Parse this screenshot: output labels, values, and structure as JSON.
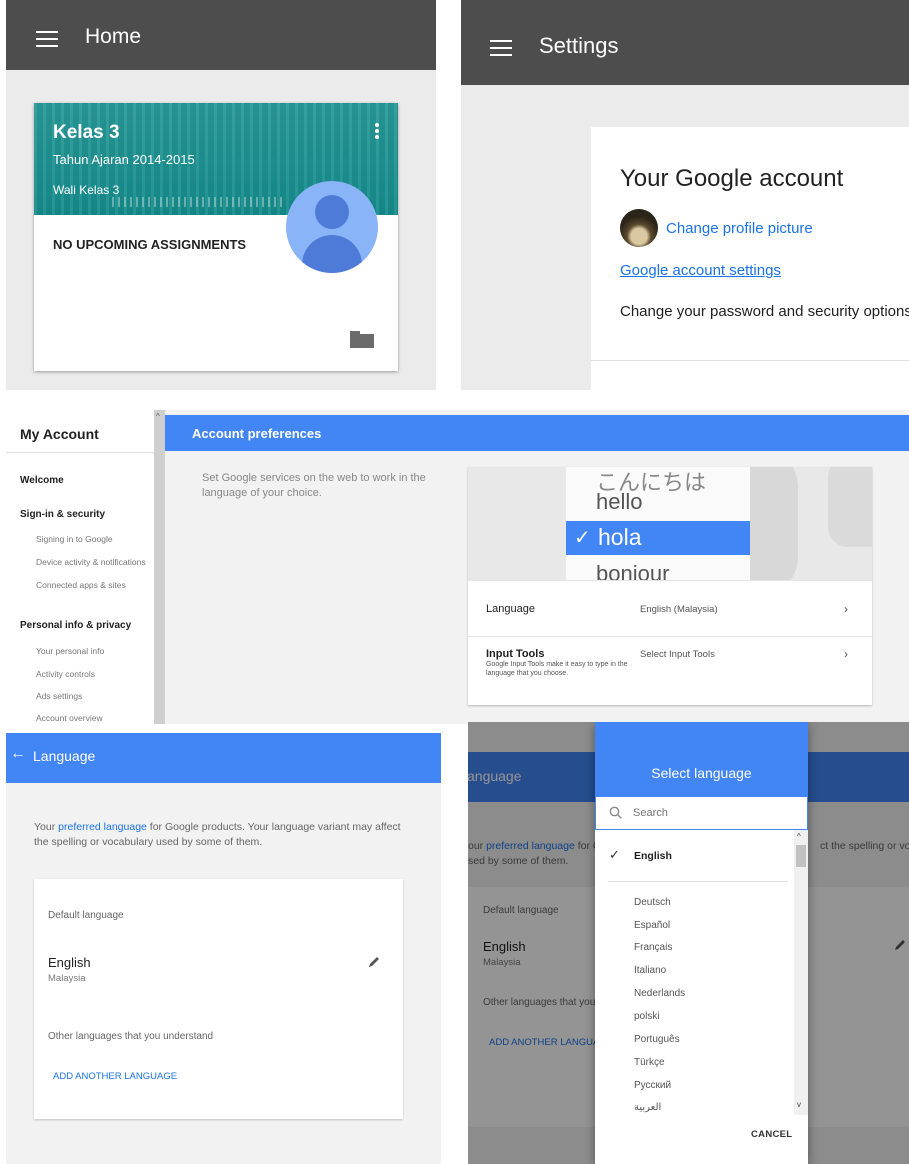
{
  "home": {
    "title": "Home",
    "class_card": {
      "name": "Kelas 3",
      "year": "Tahun Ajaran 2014-2015",
      "teacher": "Wali Kelas 3",
      "status": "NO UPCOMING ASSIGNMENTS"
    },
    "colors": {
      "appbar": "#4d4d4d",
      "card_header": "#1f9393",
      "avatar": "#8ab4f8"
    }
  },
  "settings": {
    "title": "Settings",
    "heading": "Your Google account",
    "change_picture": "Change profile picture",
    "account_settings_link": "Google account settings",
    "description": "Change your password and security options,"
  },
  "my_account": {
    "sidebar": {
      "title": "My Account",
      "items": [
        {
          "label": "Welcome",
          "type": "section"
        },
        {
          "label": "Sign-in & security",
          "type": "section"
        },
        {
          "label": "Signing in to Google",
          "type": "sub"
        },
        {
          "label": "Device activity & notifications",
          "type": "sub"
        },
        {
          "label": "Connected apps & sites",
          "type": "sub"
        },
        {
          "label": "Personal info & privacy",
          "type": "section"
        },
        {
          "label": "Your personal info",
          "type": "sub"
        },
        {
          "label": "Activity controls",
          "type": "sub"
        },
        {
          "label": "Ads settings",
          "type": "sub"
        },
        {
          "label": "Account overview",
          "type": "sub"
        }
      ]
    },
    "header": "Account preferences",
    "description": "Set Google services on the web to work in the language of your choice.",
    "illustration_words": [
      "こんにちは",
      "hello",
      "hola",
      "bonjour"
    ],
    "rows": [
      {
        "label": "Language",
        "value": "English (Malaysia)"
      },
      {
        "label": "Input Tools",
        "hint": "Google Input Tools make it easy to type in the language that you choose.",
        "value": "Select Input Tools"
      }
    ],
    "colors": {
      "accent": "#4285f4"
    }
  },
  "language_page": {
    "title": "Language",
    "intro_before": "Your ",
    "intro_link": "preferred language",
    "intro_after": " for Google products. Your language variant may affect the spelling or vocabulary used by some of them.",
    "default_label": "Default language",
    "default_language": "English",
    "default_region": "Malaysia",
    "other_label": "Other languages that you understand",
    "add_button": "ADD ANOTHER LANGUAGE"
  },
  "select_language": {
    "bg_title": "anguage",
    "bg_intro_link": "preferred language",
    "bg_intro_a": "our ",
    "bg_intro_b": " for G",
    "bg_intro_right": "ct the spelling or vocal",
    "bg_intro_line2": "sed by some of them.",
    "bg_default_label": "Default language",
    "bg_language": "English",
    "bg_region": "Malaysia",
    "bg_other": "Other languages that you",
    "bg_add": "ADD ANOTHER LANGUA",
    "dialog": {
      "title": "Select language",
      "search_placeholder": "Search",
      "selected": "English",
      "options": [
        "Deutsch",
        "Español",
        "Français",
        "Italiano",
        "Nederlands",
        "polski",
        "Português",
        "Türkçe",
        "Русский",
        "العربية"
      ],
      "cancel": "CANCEL"
    }
  }
}
